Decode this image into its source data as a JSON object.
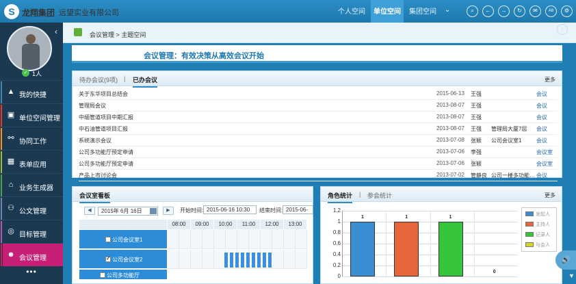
{
  "app": {
    "brand": "龙翔集团",
    "company": "远望实业有限公司"
  },
  "nav": {
    "tabs": [
      "个人空间",
      "单位空间",
      "集团空间"
    ],
    "active": 1
  },
  "toolbar_icons": [
    "search-icon",
    "back-icon",
    "forward-icon",
    "refresh-icon",
    "message-icon",
    "text-size-icon",
    "settings-icon"
  ],
  "user": {
    "online_count": "1人"
  },
  "sidebar": {
    "items": [
      {
        "label": "我的快捷",
        "icon": "quick-icon",
        "color": "#2a8ed0"
      },
      {
        "label": "单位空间管理",
        "icon": "org-icon",
        "color": "#d53c3c"
      },
      {
        "label": "协同工作",
        "icon": "collab-icon",
        "color": "#e39a22"
      },
      {
        "label": "表单应用",
        "icon": "form-icon",
        "color": "#8ac34a"
      },
      {
        "label": "业务生成器",
        "icon": "house-icon",
        "color": "#39a870"
      },
      {
        "label": "公文管理",
        "icon": "doc-icon",
        "color": "#5b8bcf"
      },
      {
        "label": "目标管理",
        "icon": "target-icon",
        "color": "#9e5fc9"
      },
      {
        "label": "会议管理",
        "icon": "meeting-icon",
        "color": "#c81f76"
      }
    ],
    "active": 7,
    "more": "•••"
  },
  "breadcrumb": {
    "section": "会议管理",
    "separator": ">",
    "page": "主题空间"
  },
  "banner": {
    "text": "会议管理：有效决策从高效会议开始"
  },
  "meetings": {
    "tabs": [
      "待办会议(9项)",
      "已办会议"
    ],
    "active_tab": 1,
    "more": "更多",
    "rows": [
      {
        "title": "关于东华项目总结会",
        "date": "2015-06-13",
        "person": "王强",
        "room": "",
        "link": "会议"
      },
      {
        "title": "管理局会议",
        "date": "2013-08-07",
        "person": "王强",
        "room": "",
        "link": "会议"
      },
      {
        "title": "中缅管道项目中期汇报",
        "date": "2013-08-07",
        "person": "王强",
        "room": "",
        "link": "会议"
      },
      {
        "title": "中石油管道项目汇报",
        "date": "2013-08-07",
        "person": "王强",
        "room": "管理局大厦7层",
        "link": "会议"
      },
      {
        "title": "系统演示会议",
        "date": "2013-07-08",
        "person": "张颖",
        "room": "公司会议室1",
        "link": "会议"
      },
      {
        "title": "公司多功能厅预定申请",
        "date": "2013-07-06",
        "person": "李强",
        "room": "",
        "link": "会议室"
      },
      {
        "title": "公司多功能厅预定申请",
        "date": "2013-07-06",
        "person": "张颖",
        "room": "",
        "link": "会议室"
      },
      {
        "title": "产品上市讨论会",
        "date": "2013-07-02",
        "person": "管静良",
        "room": "公司一楼多功能…",
        "link": "会议"
      }
    ]
  },
  "room_board": {
    "tab": "会议室看板",
    "date": "2015年 6月 16日",
    "start_label": "开始时间:",
    "start_value": "2015-06-16 10:30",
    "end_label": "结束时间:",
    "end_value": "2015-06-",
    "hours": [
      "08:00",
      "09:00",
      "10:00",
      "11:00",
      "12:00",
      "13:00"
    ],
    "rooms": [
      {
        "name": "公司会议室1",
        "checked": false
      },
      {
        "name": "公司会议室2",
        "checked": true
      },
      {
        "name": "公司多功能厅",
        "checked": false
      }
    ]
  },
  "stats": {
    "tabs": [
      "角色统计",
      "参会统计"
    ],
    "active_tab": 0,
    "more": "更多"
  },
  "chart_data": {
    "type": "bar",
    "categories": [
      "发起人",
      "主持人",
      "记录人",
      "与会人"
    ],
    "values": [
      1,
      1,
      1,
      0
    ],
    "colors": [
      "#3a8ed1",
      "#e8643a",
      "#35c43a",
      "#d6d62a"
    ],
    "yticks": [
      "1.2",
      "1",
      "0.8",
      "0.6",
      "0.4",
      "0.2",
      "0"
    ],
    "ylim": [
      0,
      1.2
    ],
    "legend": "right",
    "grid": true
  }
}
